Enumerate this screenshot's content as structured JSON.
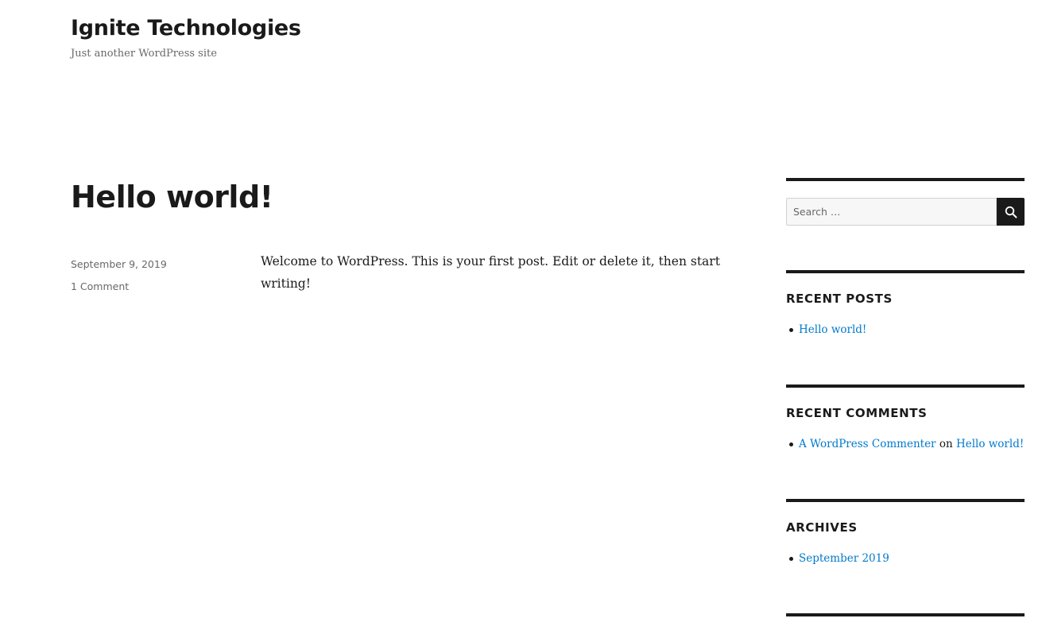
{
  "site": {
    "title": "Ignite Technologies",
    "tagline": "Just another WordPress site"
  },
  "post": {
    "title": "Hello world!",
    "date": "September 9, 2019",
    "comments": "1 Comment",
    "content": "Welcome to WordPress. This is your first post. Edit or delete it, then start writing!"
  },
  "sidebar": {
    "search": {
      "placeholder": "Search …",
      "button_icon": "search-icon"
    },
    "recent_posts": {
      "title": "RECENT POSTS",
      "items": [
        "Hello world!"
      ]
    },
    "recent_comments": {
      "title": "RECENT COMMENTS",
      "items": [
        {
          "author": "A WordPress Commenter",
          "connector": "on",
          "post": "Hello world!"
        }
      ]
    },
    "archives": {
      "title": "ARCHIVES",
      "items": [
        "September 2019"
      ]
    }
  },
  "colors": {
    "link": "#007acc",
    "text": "#1a1a1a",
    "muted": "#686868",
    "rule": "#1a1a1a"
  }
}
